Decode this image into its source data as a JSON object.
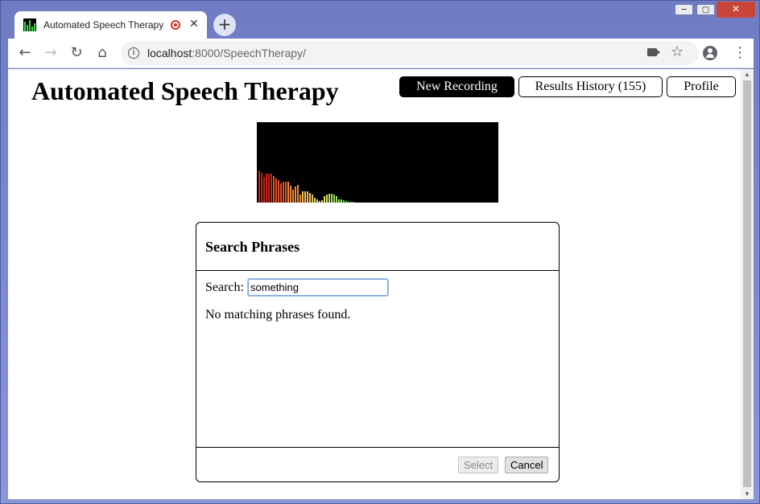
{
  "browser": {
    "tab_title": "Automated Speech Therapy",
    "tab_close": "✕",
    "new_tab": "+",
    "url_host": "localhost",
    "url_rest": ":8000/SpeechTherapy/",
    "win_min": "─",
    "win_max": "▢",
    "win_close": "✕"
  },
  "app": {
    "title": "Automated Speech Therapy",
    "nav": {
      "new_recording": "New Recording",
      "results_history": "Results History (155)",
      "profile": "Profile"
    }
  },
  "visualizer": {
    "bar_levels": [
      40,
      37,
      32,
      36,
      36,
      36,
      33,
      30,
      28,
      24,
      26,
      26,
      26,
      21,
      16,
      20,
      22,
      10,
      14,
      14,
      14,
      12,
      10,
      6,
      4,
      2,
      3,
      8,
      10,
      11,
      11,
      10,
      8,
      4,
      4,
      3,
      2,
      1,
      1,
      1
    ],
    "colors": [
      "#c0281c",
      "#e0502c",
      "#f08a3a",
      "#f4c060",
      "#dfe070",
      "#9fe060",
      "#3ad84a"
    ]
  },
  "dialog": {
    "title": "Search Phrases",
    "search_label": "Search:",
    "search_value": "something",
    "empty_message": "No matching phrases found.",
    "select_label": "Select",
    "cancel_label": "Cancel"
  }
}
